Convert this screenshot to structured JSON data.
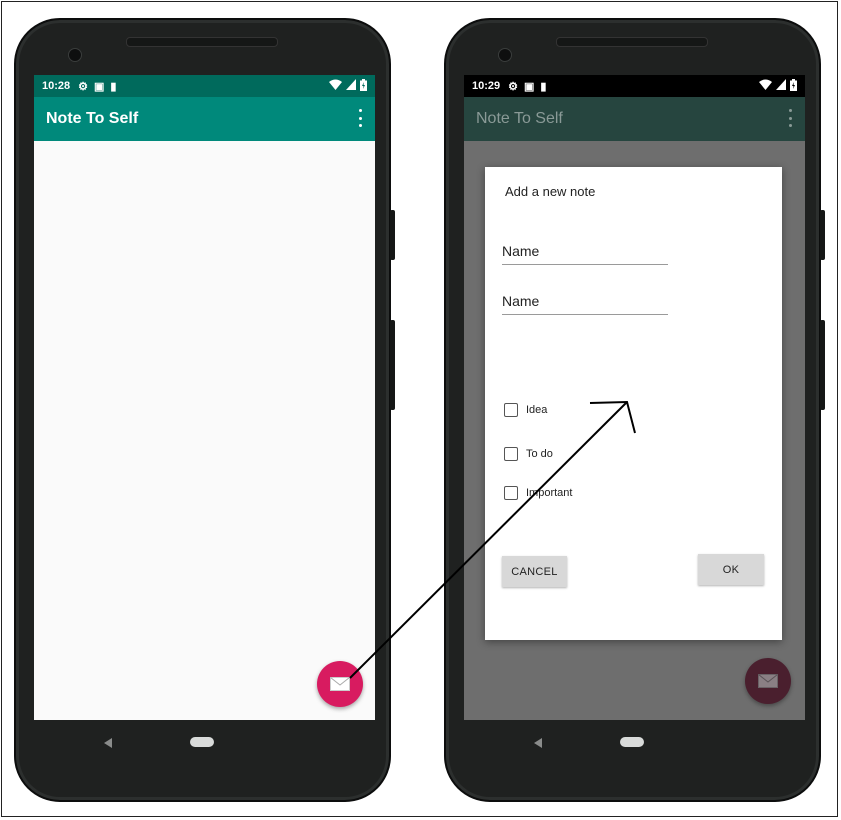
{
  "left_phone": {
    "status": {
      "time": "10:28"
    },
    "app_title": "Note To Self",
    "fab_icon": "mail-icon"
  },
  "right_phone": {
    "status": {
      "time": "10:29"
    },
    "app_title": "Note To Self",
    "dialog": {
      "title": "Add a new note",
      "fields": [
        {
          "placeholder": "Name"
        },
        {
          "placeholder": "Name"
        }
      ],
      "checkboxes": [
        {
          "label": "Idea",
          "checked": false
        },
        {
          "label": "To do",
          "checked": false
        },
        {
          "label": "Important",
          "checked": false
        }
      ],
      "cancel_label": "CANCEL",
      "ok_label": "OK"
    },
    "fab_icon": "mail-icon"
  },
  "colors": {
    "primary": "#00897b",
    "primary_dark": "#006a5c",
    "accent": "#d81b60"
  }
}
